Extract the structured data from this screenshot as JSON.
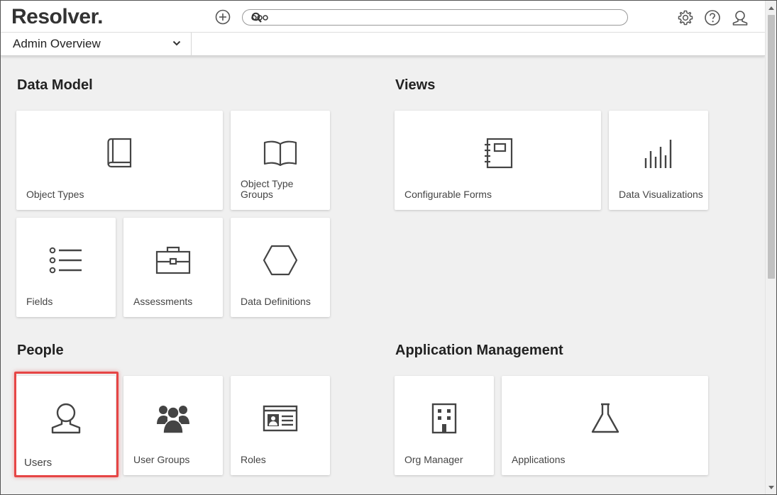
{
  "header": {
    "logo": "Resolver.",
    "search_value": "",
    "search_placeholder": "",
    "icons": [
      "plus-circle-icon",
      "search-icon",
      "more-icon",
      "gear-icon",
      "help-icon",
      "user-icon"
    ]
  },
  "subbar": {
    "dashboard_selector": "Admin Overview"
  },
  "sections": {
    "data_model": {
      "title": "Data Model",
      "tiles": [
        {
          "label": "Object Types",
          "icon": "book-icon"
        },
        {
          "label": "Object Type Groups",
          "icon": "open-book-icon"
        },
        {
          "label": "Fields",
          "icon": "list-icon"
        },
        {
          "label": "Assessments",
          "icon": "briefcase-icon"
        },
        {
          "label": "Data Definitions",
          "icon": "hexagon-icon"
        }
      ]
    },
    "views": {
      "title": "Views",
      "tiles": [
        {
          "label": "Configurable Forms",
          "icon": "notebook-icon"
        },
        {
          "label": "Data Visualizations",
          "icon": "bar-chart-icon"
        }
      ]
    },
    "people": {
      "title": "People",
      "tiles": [
        {
          "label": "Users",
          "icon": "user-icon"
        },
        {
          "label": "User Groups",
          "icon": "user-group-icon"
        },
        {
          "label": "Roles",
          "icon": "id-card-icon"
        }
      ]
    },
    "app_management": {
      "title": "Application Management",
      "tiles": [
        {
          "label": "Org Manager",
          "icon": "building-icon"
        },
        {
          "label": "Applications",
          "icon": "flask-icon"
        }
      ]
    }
  },
  "colors": {
    "highlight": "#e64545",
    "background": "#f0f0f0",
    "icon": "#444444"
  }
}
